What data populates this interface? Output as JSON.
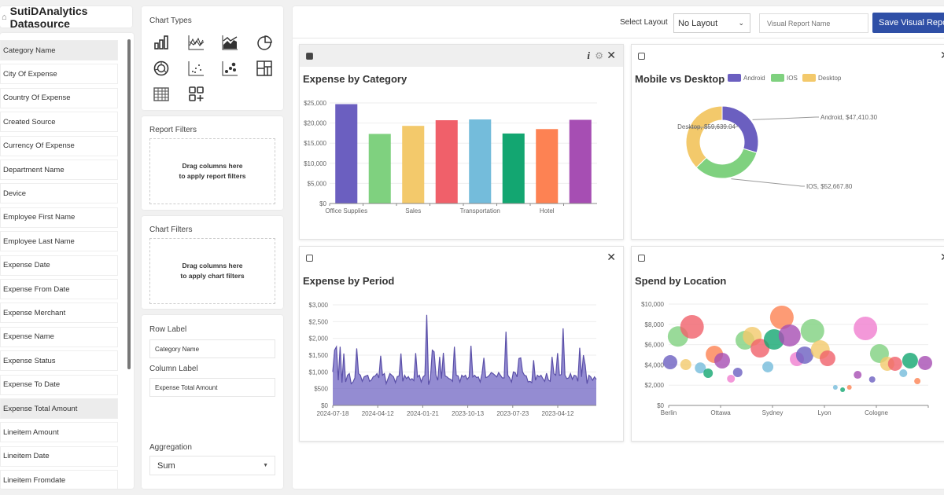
{
  "datasource": {
    "title": "SutiDAnalytics Datasource",
    "icon": "database-icon",
    "fields": [
      {
        "label": "Category Name",
        "selected": true
      },
      {
        "label": "City Of Expense"
      },
      {
        "label": "Country Of Expense"
      },
      {
        "label": "Created Source"
      },
      {
        "label": "Currency Of Expense"
      },
      {
        "label": "Department Name"
      },
      {
        "label": "Device"
      },
      {
        "label": "Employee First Name"
      },
      {
        "label": "Employee Last Name"
      },
      {
        "label": "Expense Date"
      },
      {
        "label": "Expense From Date"
      },
      {
        "label": "Expense Merchant"
      },
      {
        "label": "Expense Name"
      },
      {
        "label": "Expense Status"
      },
      {
        "label": "Expense To Date"
      },
      {
        "label": "Expense Total Amount",
        "selected": true
      },
      {
        "label": "Lineitem Amount"
      },
      {
        "label": "Lineitem Date"
      },
      {
        "label": "Lineitem Fromdate"
      }
    ]
  },
  "chart_types": {
    "title": "Chart Types",
    "icons": [
      "bar-chart-icon",
      "line-chart-icon",
      "area-chart-icon",
      "pie-chart-icon",
      "donut-chart-icon",
      "scatter-chart-icon",
      "bubble-chart-icon",
      "treemap-icon",
      "table-icon",
      "add-widget-icon"
    ]
  },
  "report_filters": {
    "title": "Report Filters",
    "hint1": "Drag columns here",
    "hint2": "to apply report filters"
  },
  "chart_filters": {
    "title": "Chart Filters",
    "hint1": "Drag columns here",
    "hint2": "to apply chart filters"
  },
  "config": {
    "row_label": "Row Label",
    "row_value": "Category Name",
    "column_label": "Column Label",
    "column_value": "Expense Total Amount",
    "aggregation_label": "Aggregation",
    "aggregation_value": "Sum"
  },
  "toolbar": {
    "select_layout_label": "Select Layout",
    "layout_value": "No Layout",
    "report_name_placeholder": "Visual Report Name",
    "save_label": "Save Visual Report"
  },
  "chart_data": [
    {
      "type": "bar",
      "title": "Expense by Category",
      "categories": [
        "Office Supplies",
        "",
        "Sales",
        "",
        "Transportation",
        "",
        "Hotel",
        ""
      ],
      "values": [
        24700,
        17300,
        19300,
        20700,
        20900,
        17400,
        18500,
        20800
      ],
      "colors": [
        "#6b5fc0",
        "#7fd17f",
        "#f3c96b",
        "#f0606a",
        "#74bcdb",
        "#13a671",
        "#fd8253",
        "#a64eb3"
      ],
      "yticks": [
        "$0",
        "$5,000",
        "$10,000",
        "$15,000",
        "$20,000",
        "$25,000"
      ],
      "ylim": [
        0,
        25000
      ],
      "grid": true
    },
    {
      "type": "pie",
      "title": "Mobile vs Desktop",
      "donut": true,
      "slices": [
        {
          "name": "Android",
          "value": 47410.3,
          "label": "Android, $47,410.30",
          "color": "#6b5fc0"
        },
        {
          "name": "IOS",
          "value": 52667.8,
          "label": "IOS, $52,667.80",
          "color": "#7fd17f"
        },
        {
          "name": "Desktop",
          "value": 59639.04,
          "label": "Desktop, $59,639.04",
          "color": "#f3c96b"
        }
      ],
      "legend": "top"
    },
    {
      "type": "area",
      "title": "Expense by Period",
      "color": "#6b5fc0",
      "xticks": [
        "2024-07-18",
        "2024-04-12",
        "2024-01-21",
        "2023-10-13",
        "2023-07-23",
        "2023-04-12"
      ],
      "yticks": [
        "$0",
        "$500",
        "$1,000",
        "$1,500",
        "$2,000",
        "$2,500",
        "$3,000"
      ],
      "ylim": [
        0,
        3000
      ],
      "values": [
        1000,
        1650,
        1750,
        750,
        1750,
        680,
        1550,
        700,
        900,
        950,
        650,
        700,
        820,
        1700,
        950,
        900,
        720,
        850,
        880,
        900,
        720,
        760,
        860,
        880,
        950,
        820,
        1480,
        900,
        950,
        650,
        800,
        950,
        900,
        850,
        680,
        860,
        880,
        1550,
        720,
        900,
        800,
        860,
        760,
        800,
        740,
        1560,
        850,
        900,
        700,
        850,
        900,
        2700,
        620,
        800,
        1650,
        1600,
        900,
        750,
        1450,
        800,
        1570,
        880,
        850,
        800,
        780,
        720,
        1750,
        900,
        880,
        700,
        900,
        850,
        900,
        780,
        850,
        1780,
        850,
        900,
        830,
        850,
        700,
        950,
        1420,
        830,
        850,
        900,
        980,
        950,
        900,
        850,
        980,
        900,
        820,
        820,
        2200,
        900,
        820,
        700,
        1000,
        980,
        850,
        1400,
        1420,
        1000,
        900,
        880,
        700,
        720,
        680,
        1350,
        750,
        900,
        850,
        900,
        800,
        720,
        960,
        760,
        720,
        1450,
        950,
        900,
        1560,
        900,
        920,
        2300,
        900,
        800,
        820,
        950,
        780,
        900,
        880,
        720,
        1720,
        850,
        1500,
        1200,
        650,
        900,
        850,
        750,
        850,
        780
      ],
      "grid": true
    },
    {
      "type": "scatter",
      "title": "Spend by Location",
      "xticks": [
        "Berlin",
        "Ottawa",
        "Sydney",
        "Lyon",
        "Cologne"
      ],
      "yticks": [
        "$0",
        "$2,000",
        "$4,000",
        "$6,000",
        "$8,000",
        "$10,000"
      ],
      "ylim": [
        0,
        10000
      ],
      "points": [
        [
          0.03,
          4260,
          9,
          "#6b5fc0"
        ],
        [
          0.18,
          6800,
          13,
          "#7fd17f"
        ],
        [
          0.45,
          7750,
          15,
          "#f0606a"
        ],
        [
          0.33,
          4030,
          7,
          "#f3c96b"
        ],
        [
          0.61,
          3700,
          7,
          "#74bcdb"
        ],
        [
          0.76,
          3180,
          6,
          "#13a671"
        ],
        [
          0.88,
          5040,
          11,
          "#fd8253"
        ],
        [
          1.03,
          4420,
          10,
          "#a64eb3"
        ],
        [
          1.2,
          2640,
          5,
          "#f07ed0"
        ],
        [
          1.33,
          3260,
          6,
          "#6b5fc0"
        ],
        [
          1.47,
          6430,
          12,
          "#7fd17f"
        ],
        [
          1.61,
          6820,
          12,
          "#f3c96b"
        ],
        [
          1.76,
          5650,
          12,
          "#f0606a"
        ],
        [
          1.91,
          3800,
          7,
          "#74bcdb"
        ],
        [
          2.03,
          6510,
          13,
          "#13a671"
        ],
        [
          2.18,
          8680,
          15,
          "#fd8253"
        ],
        [
          2.33,
          6900,
          14,
          "#a64eb3"
        ],
        [
          2.47,
          4570,
          9,
          "#f07ed0"
        ],
        [
          2.62,
          4960,
          11,
          "#6b5fc0"
        ],
        [
          2.77,
          7360,
          15,
          "#7fd17f"
        ],
        [
          2.92,
          5500,
          12,
          "#f3c96b"
        ],
        [
          3.06,
          4650,
          10,
          "#f0606a"
        ],
        [
          3.21,
          1780,
          3,
          "#74bcdb"
        ],
        [
          3.35,
          1550,
          3,
          "#13a671"
        ],
        [
          3.48,
          1780,
          3,
          "#fd8253"
        ],
        [
          3.64,
          3020,
          5,
          "#a64eb3"
        ],
        [
          3.79,
          7600,
          15,
          "#f07ed0"
        ],
        [
          3.92,
          2560,
          4,
          "#6b5fc0"
        ],
        [
          4.06,
          5120,
          12,
          "#7fd17f"
        ],
        [
          4.21,
          4110,
          9,
          "#f3c96b"
        ],
        [
          4.36,
          4110,
          9,
          "#f0606a"
        ],
        [
          4.52,
          3180,
          5,
          "#74bcdb"
        ],
        [
          4.65,
          4420,
          10,
          "#13a671"
        ],
        [
          4.79,
          2400,
          4,
          "#fd8253"
        ],
        [
          4.94,
          4190,
          9,
          "#a64eb3"
        ]
      ],
      "grid": true
    }
  ]
}
